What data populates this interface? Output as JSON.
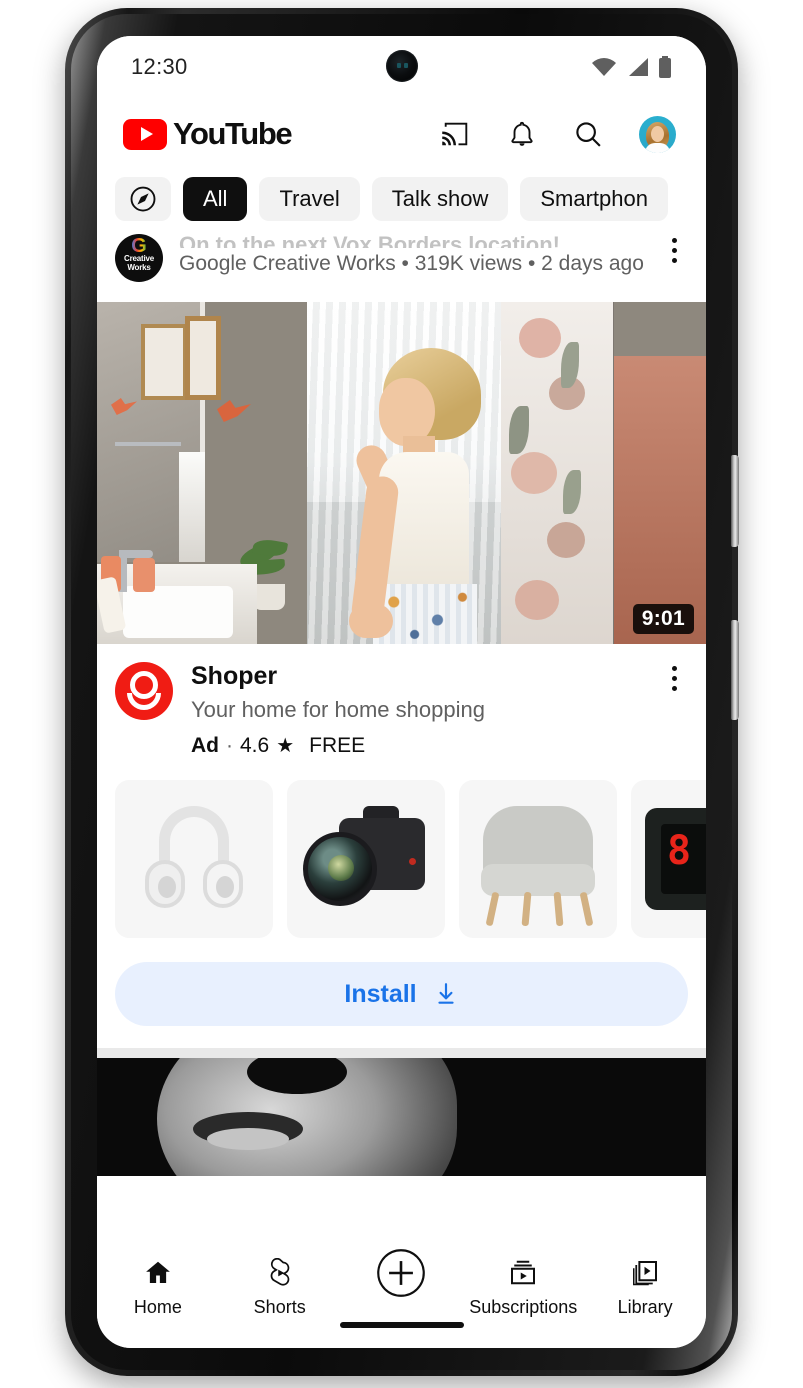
{
  "status_bar": {
    "time": "12:30",
    "icons": [
      "wifi-icon",
      "cellular-signal-icon",
      "battery-icon"
    ]
  },
  "header": {
    "brand": "YouTube",
    "icons": [
      "cast-icon",
      "notifications-bell-icon",
      "search-icon",
      "avatar"
    ]
  },
  "chips": [
    {
      "label": "",
      "icon": "compass-explore-icon",
      "active": false
    },
    {
      "label": "All",
      "active": true
    },
    {
      "label": "Travel",
      "active": false
    },
    {
      "label": "Talk show",
      "active": false
    },
    {
      "label": "Smartphon",
      "active": false
    }
  ],
  "feed": {
    "top_video": {
      "title": "On to the next Vox Borders location!",
      "meta": "Google Creative Works • 319K views • 2 days ago",
      "channel": "Google Creative Works",
      "views": "319K views",
      "age": "2 days ago",
      "avatar_text": "Creative Works",
      "avatar_letter": "G"
    },
    "featured_video": {
      "duration": "9:01",
      "scene": "woman in bathroom by window"
    },
    "ad": {
      "app_name": "Shoper",
      "tagline": "Your home for home shopping",
      "badge": "Ad",
      "separator": "·",
      "rating": "4.6",
      "star": "★",
      "price": "FREE",
      "install_label": "Install",
      "install_icon": "download-icon",
      "overflow_icon": "more-vertical-icon",
      "products": [
        {
          "name": "white-headphones"
        },
        {
          "name": "dslr-camera"
        },
        {
          "name": "grey-armchair"
        },
        {
          "name": "digital-clock"
        }
      ]
    },
    "next_video": {
      "scene": "black and white face close-up"
    }
  },
  "bottom_nav": [
    {
      "label": "Home",
      "icon": "home-icon",
      "active": true
    },
    {
      "label": "Shorts",
      "icon": "shorts-icon",
      "active": false
    },
    {
      "label": "",
      "icon": "create-plus-icon",
      "active": false
    },
    {
      "label": "Subscriptions",
      "icon": "subscriptions-icon",
      "active": false
    },
    {
      "label": "Library",
      "icon": "library-icon",
      "active": false
    }
  ],
  "colors": {
    "brand_red": "#ff0000",
    "chip_active": "#0f0f0f",
    "chip_bg": "#f2f2f2",
    "install_bg": "#e8f0fe",
    "install_text": "#1a73e8",
    "ad_icon": "#f01c14",
    "secondary_text": "#606060"
  }
}
